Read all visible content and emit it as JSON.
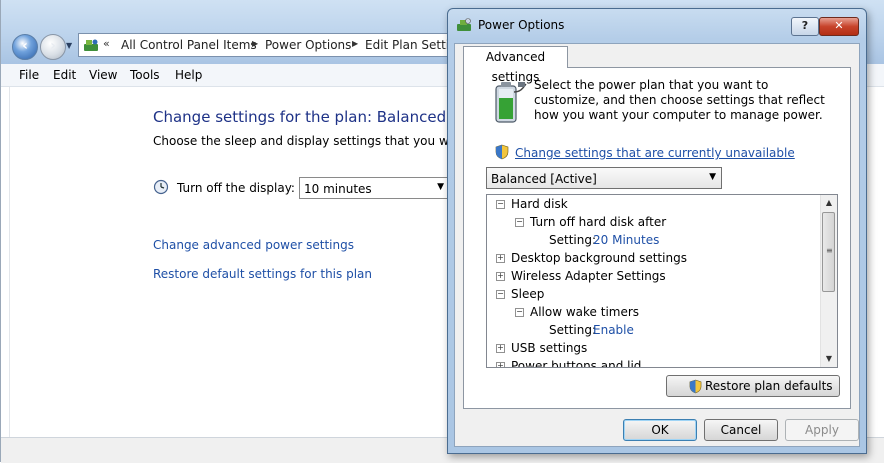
{
  "control_panel": {
    "breadcrumb": [
      "All Control Panel Items",
      "Power Options",
      "Edit Plan Settings"
    ],
    "breadcrumb_chevron": "«",
    "menu": [
      "File",
      "Edit",
      "View",
      "Tools",
      "Help"
    ],
    "heading": "Change settings for the plan: Balanced",
    "subheading": "Choose the sleep and display settings that you want your computer to use.",
    "display_label": "Turn off the display:",
    "display_value": "10 minutes",
    "link_advanced": "Change advanced power settings",
    "link_restore": "Restore default settings for this plan"
  },
  "dialog": {
    "title": "Power Options",
    "help_glyph": "?",
    "close_glyph": "✕",
    "tab_label": "Advanced settings",
    "intro_text": "Select the power plan that you want to customize, and then choose settings that reflect how you want your computer to manage power.",
    "unavailable_link": "Change settings that are currently unavailable",
    "plan_selected": "Balanced [Active]",
    "tree": [
      {
        "label": "Hard disk",
        "expander": "−"
      },
      {
        "label": "Turn off hard disk after",
        "expander": "−"
      },
      {
        "label": "Setting:",
        "value": "20 Minutes"
      },
      {
        "label": "Desktop background settings",
        "expander": "+"
      },
      {
        "label": "Wireless Adapter Settings",
        "expander": "+"
      },
      {
        "label": "Sleep",
        "expander": "−"
      },
      {
        "label": "Allow wake timers",
        "expander": "−"
      },
      {
        "label": "Setting:",
        "value": "Enable"
      },
      {
        "label": "USB settings",
        "expander": "+"
      },
      {
        "label": "Power buttons and lid",
        "expander": "+"
      }
    ],
    "restore_button": "Restore plan defaults",
    "ok_button": "OK",
    "cancel_button": "Cancel",
    "apply_button": "Apply"
  },
  "colors": {
    "link_blue": "#1e4fa6",
    "heading_blue": "#1e3287",
    "titlebar_blue": "#b4cde8"
  }
}
